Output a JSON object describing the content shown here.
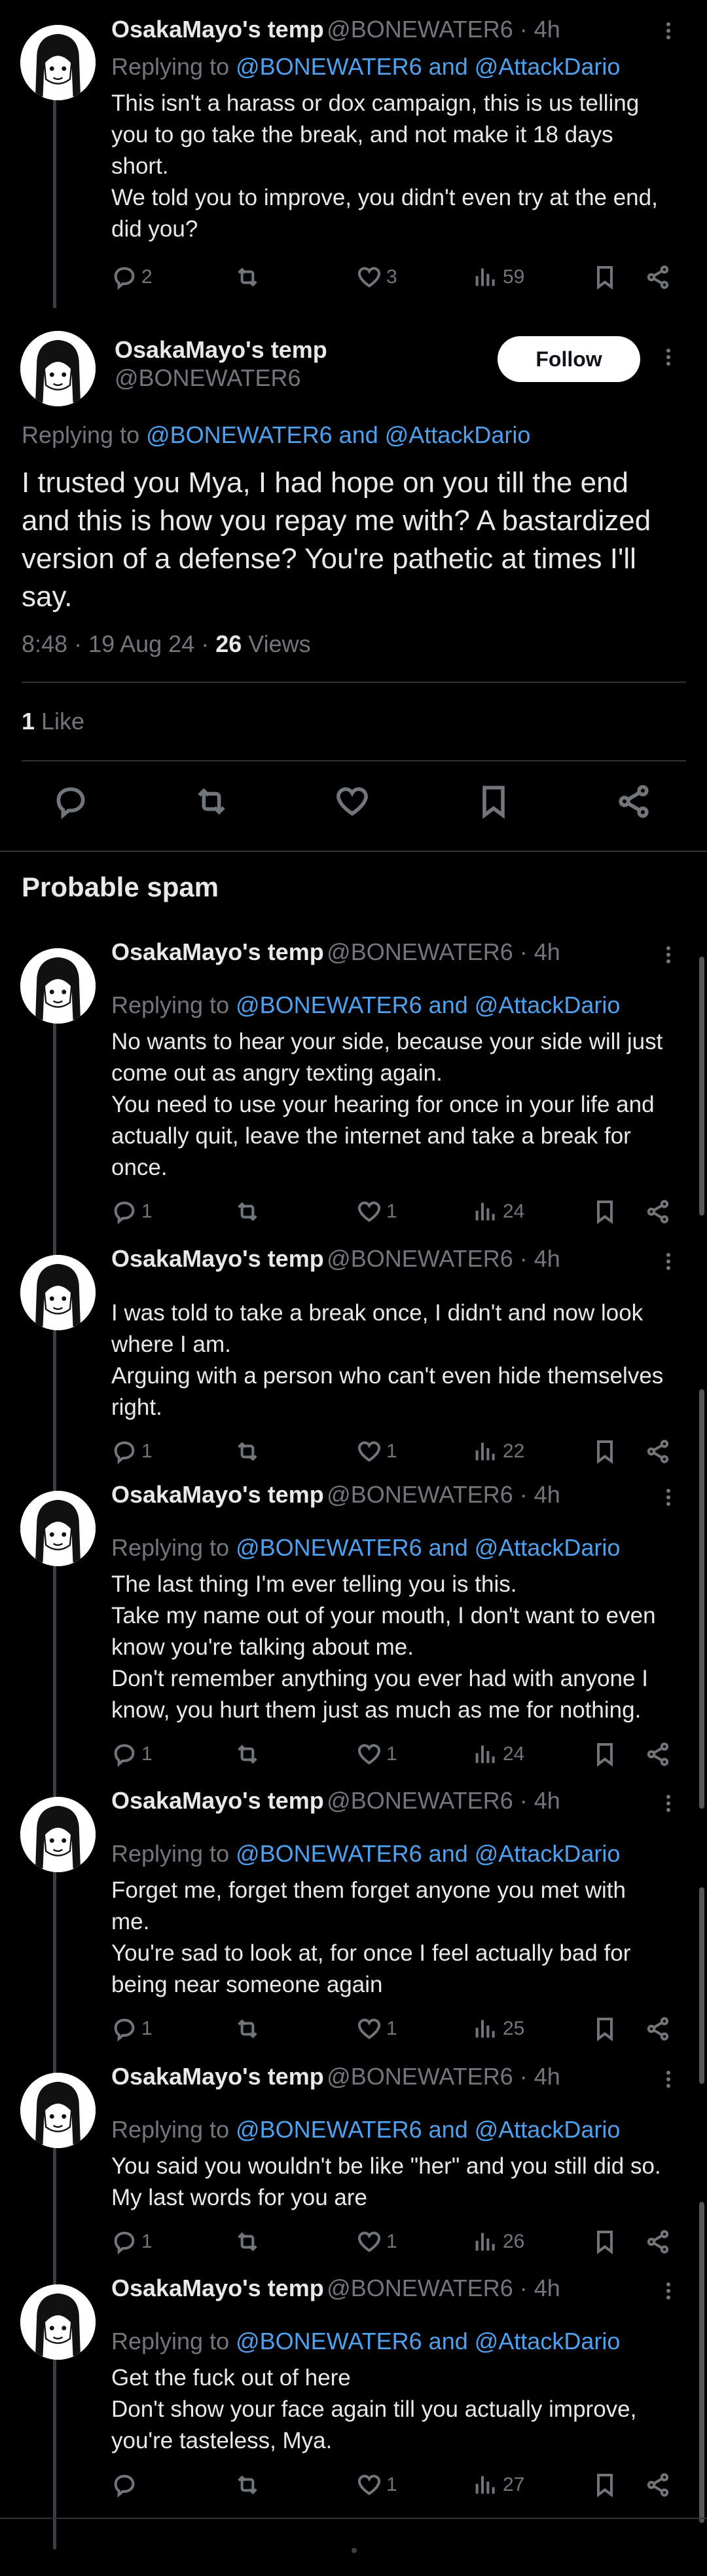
{
  "replies": [
    {
      "name": "OsakaMayo's temp",
      "meta": "@BONEWATER6 · 4h",
      "replying_prefix": "Replying to ",
      "replying_to": "@BONEWATER6 and @AttackDario",
      "lines": [
        "This isn't a harass or dox campaign, this is us telling",
        "you to go take the break, and not make it 18 days",
        "short.",
        "We told you to improve, you didn't even try at the end,",
        "did you?"
      ],
      "replies": "2",
      "reposts": "",
      "likes": "3",
      "views": "59"
    }
  ],
  "main_tweet": {
    "name": "OsakaMayo's temp",
    "handle": "@BONEWATER6",
    "follow_label": "Follow",
    "replying_prefix": "Replying to ",
    "replying_to": "@BONEWATER6 and @AttackDario",
    "lines": [
      "I trusted you Mya, I had hope on you till the end",
      "and this is how you repay me with? A bastardized",
      "version of a defense? You're pathetic at times I'll",
      "say."
    ],
    "time": "8:48 · 19 Aug 24 · ",
    "views_count": "26",
    "views_label": " Views",
    "likes_count": "1",
    "likes_label": " Like"
  },
  "section_title": "Probable spam",
  "spam_replies": [
    {
      "name": "OsakaMayo's temp",
      "meta": "@BONEWATER6 · 4h",
      "replying_prefix": "Replying to ",
      "replying_to": "@BONEWATER6 and @AttackDario",
      "lines": [
        "No wants to hear your side, because your side will just",
        "come out as angry texting again.",
        "You need to use your hearing for once in your life and",
        "actually quit, leave the internet and take a break for",
        "once."
      ],
      "replies": "1",
      "reposts": "",
      "likes": "1",
      "views": "24"
    },
    {
      "name": "OsakaMayo's temp",
      "meta": "@BONEWATER6 · 4h",
      "replying_prefix": "",
      "replying_to": "",
      "lines": [
        "I was told to take a break once, I didn't and now look",
        "where I am.",
        "Arguing with a person who can't even hide themselves",
        "right."
      ],
      "replies": "1",
      "reposts": "",
      "likes": "1",
      "views": "22"
    },
    {
      "name": "OsakaMayo's temp",
      "meta": "@BONEWATER6 · 4h",
      "replying_prefix": "Replying to ",
      "replying_to": "@BONEWATER6 and @AttackDario",
      "lines": [
        "The last thing I'm ever telling you is this.",
        "Take my name out of your mouth, I don't want to even",
        "know you're talking about me.",
        "Don't remember anything you ever had with anyone I",
        "know, you hurt them just as much as me for nothing."
      ],
      "replies": "1",
      "reposts": "",
      "likes": "1",
      "views": "24"
    },
    {
      "name": "OsakaMayo's temp",
      "meta": "@BONEWATER6 · 4h",
      "replying_prefix": "Replying to ",
      "replying_to": "@BONEWATER6 and @AttackDario",
      "lines": [
        "Forget me, forget them forget anyone you met with",
        "me.",
        "You're sad to look at, for once I feel actually bad for",
        "being near someone again"
      ],
      "replies": "1",
      "reposts": "",
      "likes": "1",
      "views": "25"
    },
    {
      "name": "OsakaMayo's temp",
      "meta": "@BONEWATER6 · 4h",
      "replying_prefix": "Replying to ",
      "replying_to": "@BONEWATER6 and @AttackDario",
      "lines": [
        "You said you wouldn't be like \"her\" and you still did so.",
        "My last words for you are"
      ],
      "replies": "1",
      "reposts": "",
      "likes": "1",
      "views": "26"
    },
    {
      "name": "OsakaMayo's temp",
      "meta": "@BONEWATER6 · 4h",
      "replying_prefix": "Replying to ",
      "replying_to": "@BONEWATER6 and @AttackDario",
      "lines": [
        "Get the fuck out of here",
        "Don't show your face again till you actually improve,",
        "you're tasteless, Mya."
      ],
      "replies": "",
      "reposts": "",
      "likes": "1",
      "views": "27"
    }
  ],
  "icons": {
    "reply": "reply-icon",
    "repost": "repost-icon",
    "like": "heart-icon",
    "views": "views-icon",
    "bookmark": "bookmark-icon",
    "share": "share-icon",
    "more": "more-icon"
  },
  "colors": {
    "background": "#000000",
    "link": "#4ea1ef",
    "muted": "#71767b",
    "text": "#e7e9ea"
  }
}
